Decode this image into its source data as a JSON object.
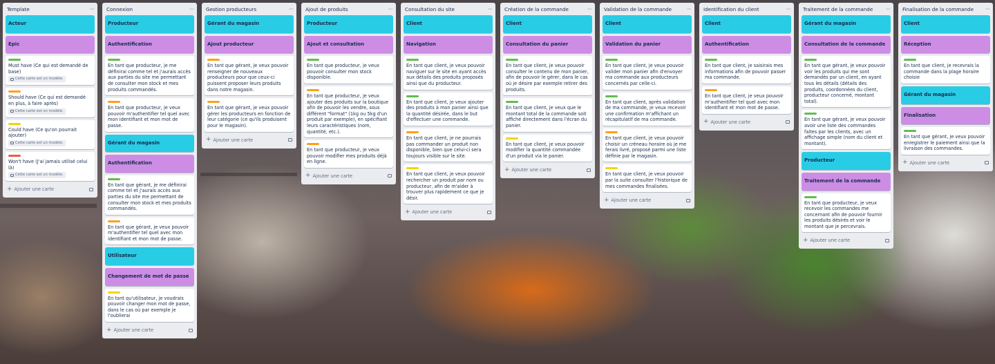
{
  "lists": [
    {
      "title": "Template",
      "cards": [
        {
          "kind": "cyan",
          "text": "Acteur"
        },
        {
          "kind": "purple",
          "text": "Epic"
        },
        {
          "kind": "text",
          "label": "green",
          "text": "Must have (Ce qui est demandé de base)",
          "badge": "Cette carte est un modèle."
        },
        {
          "kind": "text",
          "label": "orange",
          "text": "Should have (Ce qui est demandé en plus, à faire après)",
          "badge": "Cette carte est un modèle."
        },
        {
          "kind": "text",
          "label": "yellow",
          "text": "Could have (Ce qu'on pourrait ajouter)",
          "badge": "Cette carte est un modèle."
        },
        {
          "kind": "text",
          "label": "red",
          "text": "Won't have (J'ai jamais utilisé celui là)",
          "badge": "Cette carte est un modèle."
        }
      ],
      "add_label": "Ajouter une carte"
    },
    {
      "title": "Connexion",
      "cards": [
        {
          "kind": "cyan",
          "text": "Producteur"
        },
        {
          "kind": "purple",
          "text": "Authentification"
        },
        {
          "kind": "text",
          "label": "green",
          "text": "En tant que producteur, je me définirai comme tel et j'aurais accès aux parties du site me permettant de consulter mon stock et mes produits commandés."
        },
        {
          "kind": "text",
          "label": "orange",
          "text": "En tant que producteur, je veux pouvoir m'authentifier tel quel avec mon identifiant et mon mot de passe."
        },
        {
          "kind": "cyan",
          "text": "Gérant du magasin"
        },
        {
          "kind": "purple",
          "text": "Authentification"
        },
        {
          "kind": "text",
          "label": "green",
          "text": "En tant que gérant, je me définirai comme tel et j'aurais accès aux parties du site me permettant de consulter mon stock et mes produits commandés."
        },
        {
          "kind": "text",
          "label": "orange",
          "text": "En tant que gérant, je veux pouvoir m'authentifier tel quel avec mon identifiant et mon mot de passe."
        },
        {
          "kind": "cyan",
          "text": "Utilisateur"
        },
        {
          "kind": "purple",
          "text": "Changement de mot de passe"
        },
        {
          "kind": "text",
          "label": "yellow",
          "text": "En tant qu'utilisateur, je voudrais pouvoir changer mon mot de passe, dans le cas où par exemple je l'oublierai"
        }
      ],
      "add_label": "Ajouter une carte"
    },
    {
      "title": "Gestion producteurs",
      "cards": [
        {
          "kind": "cyan",
          "text": "Gérant du magasin"
        },
        {
          "kind": "purple",
          "text": "Ajout producteur"
        },
        {
          "kind": "text",
          "label": "orange",
          "text": "En tant que gérant, je veux pouvoir renseigner de nouveaux producteurs pour que ceux-ci puissent proposer leurs produits dans notre magasin."
        },
        {
          "kind": "text",
          "label": "orange",
          "text": "En tant que gérant, je veux pouvoir gérer les producteurs en fonction de leur catégorie (ce qu'ils produisent pour le magasin)."
        }
      ],
      "add_label": "Ajouter une carte"
    },
    {
      "title": "Ajout de produits",
      "cards": [
        {
          "kind": "cyan",
          "text": "Producteur"
        },
        {
          "kind": "purple",
          "text": "Ajout et consultation"
        },
        {
          "kind": "text",
          "label": "green",
          "text": "En tant que producteur, je veux pouvoir consulter mon stock disponible."
        },
        {
          "kind": "text",
          "label": "orange",
          "text": "En tant que producteur, je veux ajouter des produits sur la boutique afin de pouvoir les vendre, sous différent \"format\" (1kg ou 5kg d'un produit par exemple), en spécifiant leurs caractéristiques (nom, quantité, etc.)."
        },
        {
          "kind": "text",
          "label": "orange",
          "text": "En tant que producteur, je veux pouvoir modifier mes produits déjà en ligne."
        }
      ],
      "add_label": "Ajouter une carte"
    },
    {
      "title": "Consultation du site",
      "cards": [
        {
          "kind": "cyan",
          "text": "Client"
        },
        {
          "kind": "purple",
          "text": "Navigation"
        },
        {
          "kind": "text",
          "label": "green",
          "text": "En tant que client, je veux pouvoir naviguer sur le site en ayant accès aux détails des produits proposés ainsi que du producteur."
        },
        {
          "kind": "text",
          "label": "green",
          "text": "En tant que client, je veux ajouter des produits à mon panier ainsi que la quantité désirée, dans le but d'effectuer une commande."
        },
        {
          "kind": "text",
          "label": "orange",
          "text": "En tant que client, je ne pourrais pas commander un produit non disponible, bien que celui-ci sera toujours visible sur le site."
        },
        {
          "kind": "text",
          "label": "yellow",
          "text": "En tant que client, je veux pouvoir rechercher un produit par nom ou producteur, afin de m'aider à trouver plus rapidement ce que je désir."
        }
      ],
      "add_label": "Ajouter une carte"
    },
    {
      "title": "Création de la commande",
      "cards": [
        {
          "kind": "cyan",
          "text": "Client"
        },
        {
          "kind": "purple",
          "text": "Consultation du panier"
        },
        {
          "kind": "text",
          "label": "green",
          "text": "En tant que client, je veux pouvoir consulter le contenu de mon panier, afin de pouvoir le gérer, dans le cas où je désire par exemple retirer des produits."
        },
        {
          "kind": "text",
          "label": "green",
          "text": "En tant que client, je veux que le montant total de la commande soit affiché directement dans l'écran du panier."
        },
        {
          "kind": "text",
          "label": "yellow",
          "text": "En tant que client, je veux pouvoir modifier la quantité commandée d'un produit via le panier."
        }
      ],
      "add_label": "Ajouter une carte"
    },
    {
      "title": "Validation de la commande",
      "cards": [
        {
          "kind": "cyan",
          "text": "Client"
        },
        {
          "kind": "purple",
          "text": "Validation du panier"
        },
        {
          "kind": "text",
          "label": "green",
          "text": "En tant que client, je veux pouvoir valider mon panier afin d'envoyer ma commande aux producteurs concernés par celle-ci."
        },
        {
          "kind": "text",
          "label": "green",
          "text": "En tant que client, après validation de ma commande, je veux recevoir une confirmation m'affichant un récapitulatif de ma commande."
        },
        {
          "kind": "text",
          "label": "orange",
          "text": "En tant que client, je veux pouvoir choisir un créneau horaire où je me ferais livré, proposé parmi une liste définie par le magasin."
        },
        {
          "kind": "text",
          "label": "yellow",
          "text": "En tant que client, je veux pouvoir par la suite consulter l'historique de mes commandes finalisées."
        }
      ],
      "add_label": "Ajouter une carte"
    },
    {
      "title": "Identification du client",
      "cards": [
        {
          "kind": "cyan",
          "text": "Client"
        },
        {
          "kind": "purple",
          "text": "Authentification"
        },
        {
          "kind": "text",
          "label": "green",
          "text": "En tant que client, je saisirais mes informations afin de pouvoir passer ma commande."
        },
        {
          "kind": "text",
          "label": "orange",
          "text": "En tant que client, je veux pouvoir m'authentifier tel quel avec mon identifiant et mon mot de passe."
        }
      ],
      "add_label": "Ajouter une carte"
    },
    {
      "title": "Traitement de la commande",
      "cards": [
        {
          "kind": "cyan",
          "text": "Gérant du magasin"
        },
        {
          "kind": "purple",
          "text": "Consultation de la commande"
        },
        {
          "kind": "text",
          "label": "green",
          "text": "En tant que gérant, je veux pouvoir voir les produits qui me sont demandés par un client, en ayant tous les détails (détails des produits, coordonnées du client, producteur concerné, montant total)."
        },
        {
          "kind": "text",
          "label": "green",
          "text": "En tant que gérant, je veux pouvoir avoir une liste des commandes faites par les clients, avec un affichage simple (nom du client et montant)."
        },
        {
          "kind": "cyan",
          "text": "Producteur"
        },
        {
          "kind": "purple",
          "text": "Traitement de la commande"
        },
        {
          "kind": "text",
          "label": "green",
          "text": "En tant que producteur, je veux recevoir les commandes me concernant afin de pouvoir fournir les produits désirés et voir le montant que je percevrais."
        }
      ],
      "add_label": "Ajouter une carte"
    },
    {
      "title": "Finalisation de la commande",
      "cards": [
        {
          "kind": "cyan",
          "text": "Client"
        },
        {
          "kind": "purple",
          "text": "Réception"
        },
        {
          "kind": "text",
          "label": "green",
          "text": "En tant que client, je recevrais la commande dans la plage horaire choisie"
        },
        {
          "kind": "cyan",
          "text": "Gérant du magasin"
        },
        {
          "kind": "purple",
          "text": "Finalisation"
        },
        {
          "kind": "text",
          "label": "green",
          "text": "En tant que gérant, je veux pouvoir enregistrer le paiement ainsi que la livraison des commandes."
        }
      ],
      "add_label": "Ajouter une carte"
    }
  ],
  "menu_glyph": "···",
  "add_glyph": "+",
  "colors": {
    "cyan": "#29cce5",
    "purple": "#cd8de5",
    "green": "#61bd4f",
    "orange": "#ff9f1a",
    "yellow": "#f2d600",
    "red": "#eb5a46"
  },
  "icons": {
    "list_menu": "ellipsis-icon",
    "add": "plus-icon",
    "template": "template-card-icon"
  }
}
